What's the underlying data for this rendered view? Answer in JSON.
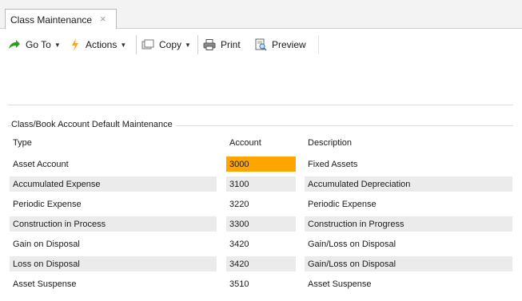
{
  "tab": {
    "title": "Class Maintenance",
    "close_glyph": "×"
  },
  "toolbar": {
    "goto_label": "Go To",
    "actions_label": "Actions",
    "copy_label": "Copy",
    "print_label": "Print",
    "preview_label": "Preview"
  },
  "section": {
    "title": "Class/Book Account Default Maintenance",
    "columns": {
      "type": "Type",
      "account": "Account",
      "description": "Description"
    },
    "rows": [
      {
        "type": "Asset Account",
        "account": "3000",
        "description": "Fixed Assets"
      },
      {
        "type": "Accumulated Expense",
        "account": "3100",
        "description": "Accumulated Depreciation"
      },
      {
        "type": "Periodic Expense",
        "account": "3220",
        "description": "Periodic Expense"
      },
      {
        "type": "Construction in Process",
        "account": "3300",
        "description": "Construction in Progress"
      },
      {
        "type": "Gain on Disposal",
        "account": "3420",
        "description": "Gain/Loss on Disposal"
      },
      {
        "type": "Loss on Disposal",
        "account": "3420",
        "description": "Gain/Loss on Disposal"
      },
      {
        "type": "Asset Suspense",
        "account": "3510",
        "description": "Asset Suspense"
      }
    ]
  },
  "colors": {
    "highlight": "#ffa500",
    "row_shade": "#ebebeb"
  }
}
